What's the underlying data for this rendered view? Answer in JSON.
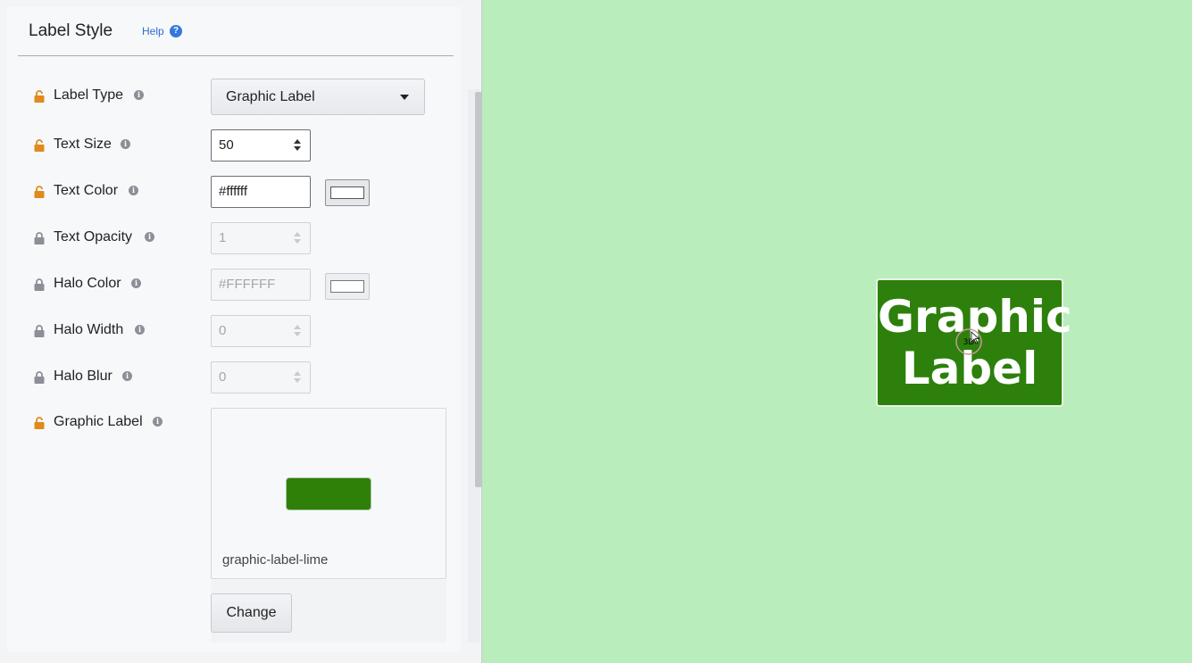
{
  "header": {
    "title": "Label Style",
    "help_label": "Help",
    "help_icon": "question-circle-icon"
  },
  "fields": {
    "label_type": {
      "label": "Label Type",
      "value": "Graphic Label",
      "locked": true
    },
    "text_size": {
      "label": "Text Size",
      "value": "50",
      "locked": true
    },
    "text_color": {
      "label": "Text Color",
      "value": "#ffffff",
      "locked": true,
      "swatch_color": "#ffffff"
    },
    "text_opacity": {
      "label": "Text Opacity",
      "value": "1",
      "locked": false
    },
    "halo_color": {
      "label": "Halo Color",
      "value": "#FFFFFF",
      "locked": false,
      "swatch_color": "#FFFFFF"
    },
    "halo_width": {
      "label": "Halo Width",
      "value": "0",
      "locked": false
    },
    "halo_blur": {
      "label": "Halo Blur",
      "value": "0",
      "locked": false
    },
    "graphic_label": {
      "label": "Graphic Label",
      "name": "graphic-label-lime",
      "locked": true,
      "preview_color": "#2f8008"
    }
  },
  "buttons": {
    "change": "Change"
  },
  "map": {
    "background_color": "#b9edbb",
    "label_line1": "Graphic",
    "label_line2": "Label",
    "label_background": "#2d800c",
    "cursor_text": "3D"
  },
  "colors": {
    "lock_active": "#e08a1e",
    "lock_inactive": "#8b9097",
    "accent": "#3478db"
  }
}
